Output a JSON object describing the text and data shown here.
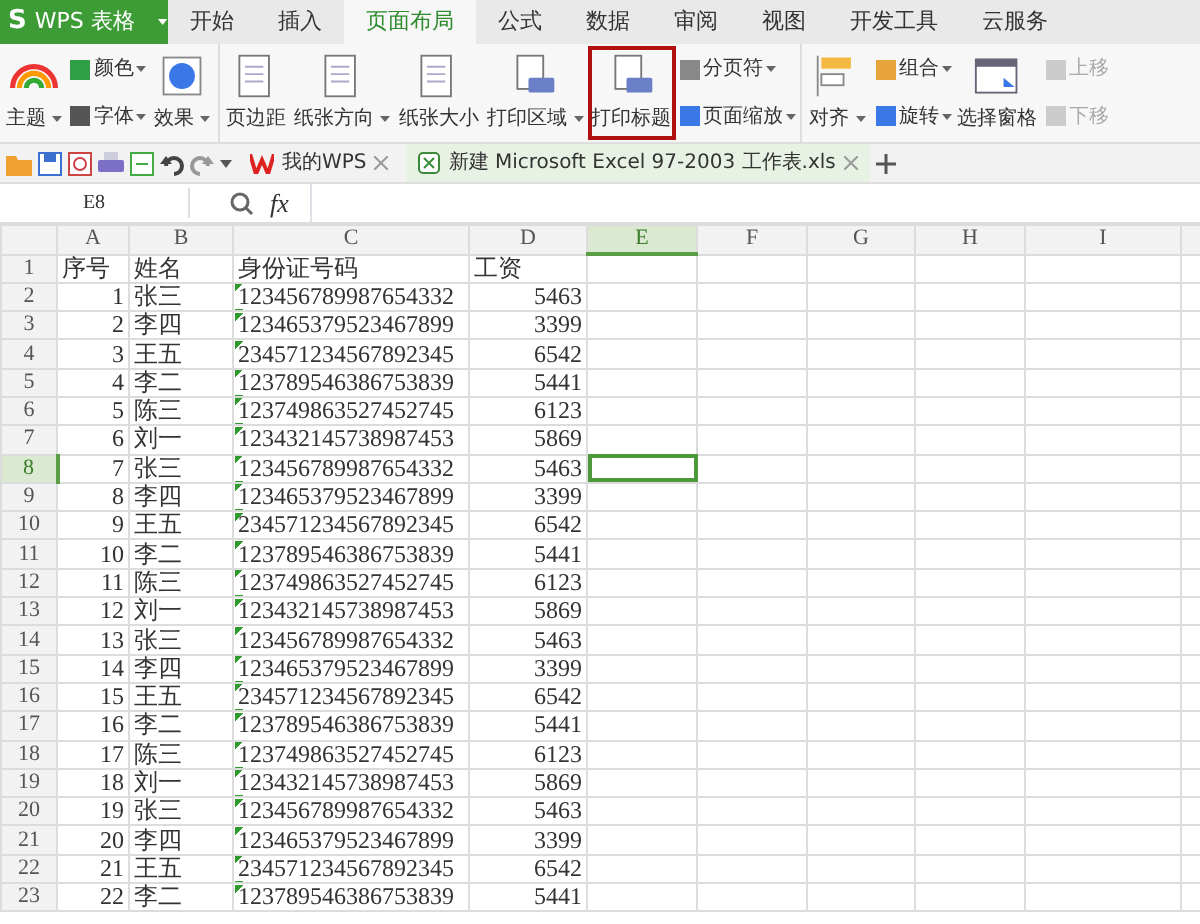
{
  "app": {
    "logo_mark": "S",
    "title": "WPS 表格"
  },
  "menu_tabs": [
    {
      "label": "开始",
      "selected": false
    },
    {
      "label": "插入",
      "selected": false
    },
    {
      "label": "页面布局",
      "selected": true
    },
    {
      "label": "公式",
      "selected": false
    },
    {
      "label": "数据",
      "selected": false
    },
    {
      "label": "审阅",
      "selected": false
    },
    {
      "label": "视图",
      "selected": false
    },
    {
      "label": "开发工具",
      "selected": false
    },
    {
      "label": "云服务",
      "selected": false
    }
  ],
  "ribbon": {
    "groups": [
      {
        "items": [
          {
            "label": "主题",
            "kind": "large",
            "dropdown": true,
            "disabled": false,
            "highlighted": false
          },
          {
            "label": "颜色",
            "kind": "small",
            "dropdown": true,
            "disabled": false
          },
          {
            "label": "字体",
            "kind": "small",
            "dropdown": true,
            "disabled": false
          },
          {
            "label": "效果",
            "kind": "large",
            "dropdown": true,
            "disabled": false,
            "highlighted": false
          }
        ]
      },
      {
        "items": [
          {
            "label": "页边距",
            "kind": "large",
            "dropdown": false,
            "disabled": false,
            "highlighted": false
          },
          {
            "label": "纸张方向",
            "kind": "large",
            "dropdown": true,
            "disabled": false,
            "highlighted": false
          },
          {
            "label": "纸张大小",
            "kind": "large",
            "dropdown": false,
            "disabled": false,
            "highlighted": false
          },
          {
            "label": "打印区域",
            "kind": "large",
            "dropdown": true,
            "disabled": false,
            "highlighted": false
          },
          {
            "label": "打印标题",
            "kind": "large",
            "dropdown": false,
            "disabled": false,
            "highlighted": true
          },
          {
            "label": "分页符",
            "kind": "small",
            "dropdown": true,
            "disabled": false
          },
          {
            "label": "页面缩放",
            "kind": "small",
            "dropdown": true,
            "disabled": false
          }
        ]
      },
      {
        "items": [
          {
            "label": "对齐",
            "kind": "large",
            "dropdown": true,
            "disabled": false,
            "highlighted": false
          },
          {
            "label": "组合",
            "kind": "small",
            "dropdown": true,
            "disabled": false
          },
          {
            "label": "旋转",
            "kind": "small",
            "dropdown": true,
            "disabled": false
          },
          {
            "label": "选择窗格",
            "kind": "large",
            "dropdown": false,
            "disabled": false,
            "highlighted": false
          },
          {
            "label": "上移",
            "kind": "small",
            "dropdown": false,
            "disabled": true
          },
          {
            "label": "下移",
            "kind": "small",
            "dropdown": false,
            "disabled": true
          }
        ]
      }
    ]
  },
  "doc_tabs": [
    {
      "label": "我的WPS",
      "selected": false
    },
    {
      "label": "新建 Microsoft Excel 97-2003 工作表.xls",
      "selected": true
    }
  ],
  "formula_bar": {
    "name_box": "E8",
    "fx": "fx"
  },
  "sheet": {
    "columns": [
      {
        "label": "A",
        "selected": false
      },
      {
        "label": "B",
        "selected": false
      },
      {
        "label": "C",
        "selected": false
      },
      {
        "label": "D",
        "selected": false
      },
      {
        "label": "E",
        "selected": true
      },
      {
        "label": "F",
        "selected": false
      },
      {
        "label": "G",
        "selected": false
      },
      {
        "label": "H",
        "selected": false
      },
      {
        "label": "I",
        "selected": false
      }
    ],
    "rows": [
      {
        "number": "1",
        "selected": false,
        "cells": [
          "序号",
          "姓名",
          "身份证号码",
          "工资"
        ]
      },
      {
        "number": "2",
        "selected": false,
        "cells": [
          "1",
          "张三",
          "123456789987654332",
          "5463"
        ]
      },
      {
        "number": "3",
        "selected": false,
        "cells": [
          "2",
          "李四",
          "123465379523467899",
          "3399"
        ]
      },
      {
        "number": "4",
        "selected": false,
        "cells": [
          "3",
          "王五",
          "234571234567892345",
          "6542"
        ]
      },
      {
        "number": "5",
        "selected": false,
        "cells": [
          "4",
          "李二",
          "123789546386753839",
          "5441"
        ]
      },
      {
        "number": "6",
        "selected": false,
        "cells": [
          "5",
          "陈三",
          "123749863527452745",
          "6123"
        ]
      },
      {
        "number": "7",
        "selected": false,
        "cells": [
          "6",
          "刘一",
          "123432145738987453",
          "5869"
        ]
      },
      {
        "number": "8",
        "selected": true,
        "cells": [
          "7",
          "张三",
          "123456789987654332",
          "5463"
        ]
      },
      {
        "number": "9",
        "selected": false,
        "cells": [
          "8",
          "李四",
          "123465379523467899",
          "3399"
        ]
      },
      {
        "number": "10",
        "selected": false,
        "cells": [
          "9",
          "王五",
          "234571234567892345",
          "6542"
        ]
      },
      {
        "number": "11",
        "selected": false,
        "cells": [
          "10",
          "李二",
          "123789546386753839",
          "5441"
        ]
      },
      {
        "number": "12",
        "selected": false,
        "cells": [
          "11",
          "陈三",
          "123749863527452745",
          "6123"
        ]
      },
      {
        "number": "13",
        "selected": false,
        "cells": [
          "12",
          "刘一",
          "123432145738987453",
          "5869"
        ]
      },
      {
        "number": "14",
        "selected": false,
        "cells": [
          "13",
          "张三",
          "123456789987654332",
          "5463"
        ]
      },
      {
        "number": "15",
        "selected": false,
        "cells": [
          "14",
          "李四",
          "123465379523467899",
          "3399"
        ]
      },
      {
        "number": "16",
        "selected": false,
        "cells": [
          "15",
          "王五",
          "234571234567892345",
          "6542"
        ]
      },
      {
        "number": "17",
        "selected": false,
        "cells": [
          "16",
          "李二",
          "123789546386753839",
          "5441"
        ]
      },
      {
        "number": "18",
        "selected": false,
        "cells": [
          "17",
          "陈三",
          "123749863527452745",
          "6123"
        ]
      },
      {
        "number": "19",
        "selected": false,
        "cells": [
          "18",
          "刘一",
          "123432145738987453",
          "5869"
        ]
      },
      {
        "number": "20",
        "selected": false,
        "cells": [
          "19",
          "张三",
          "123456789987654332",
          "5463"
        ]
      },
      {
        "number": "21",
        "selected": false,
        "cells": [
          "20",
          "李四",
          "123465379523467899",
          "3399"
        ]
      },
      {
        "number": "22",
        "selected": false,
        "cells": [
          "21",
          "王五",
          "234571234567892345",
          "6542"
        ]
      },
      {
        "number": "23",
        "selected": false,
        "cells": [
          "22",
          "李二",
          "123789546386753839",
          "5441"
        ]
      }
    ]
  }
}
